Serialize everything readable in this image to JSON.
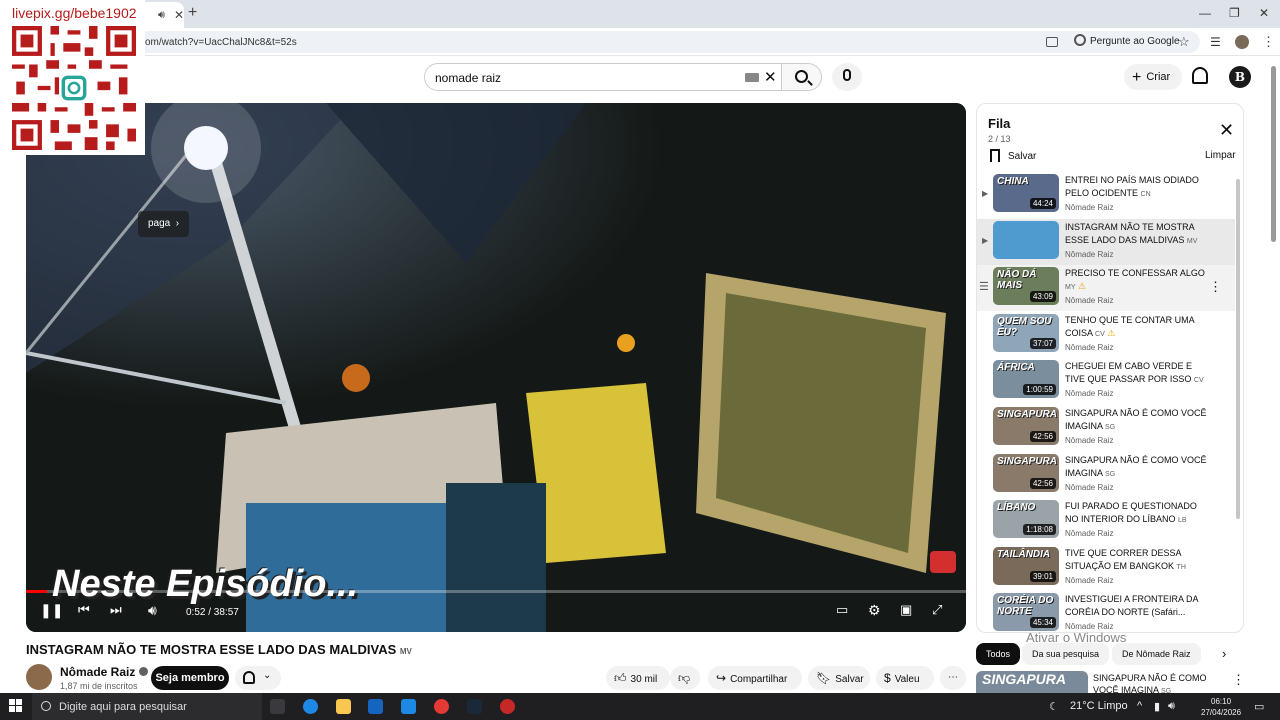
{
  "browser": {
    "tab_audio_icon": "speaker-icon",
    "url": "om/watch?v=UacChalJNc8&t=52s",
    "ask_google": "Pergunte ao Google"
  },
  "overlay": {
    "url_text": "livepix.gg/bebe1902"
  },
  "header": {
    "search_value": "nomade raiz",
    "create_label": "Criar",
    "avatar_letter": "B"
  },
  "player": {
    "badge": "paga",
    "caption": "Neste Episódio...",
    "current_time": "0:52",
    "duration": "38:57",
    "time_display": "0:52 / 38:57",
    "progress": 0.022
  },
  "video": {
    "title": "INSTAGRAM NÃO TE MOSTRA ESSE LADO DAS MALDIVAS 🇲🇻",
    "title_plain": "INSTAGRAM NÃO TE MOSTRA ESSE LADO DAS MALDIVAS",
    "title_flag": "MV",
    "channel": "Nômade Raiz",
    "subscribers": "1,87 mi de inscritos",
    "member_label": "Seja membro",
    "likes": "30 mil",
    "share_label": "Compartilhar",
    "save_label": "Salvar",
    "thanks_label": "Valeu"
  },
  "queue": {
    "title": "Fila",
    "count": "2 / 13",
    "save_label": "Salvar",
    "clear_label": "Limpar",
    "items": [
      {
        "title": "ENTREI NO PAÍS MAIS ODIADO PELO OCIDENTE",
        "flag": "CN",
        "channel": "Nômade Raiz",
        "duration": "44:24",
        "thumb_label": "CHINA",
        "thumb_color": "#5a6a8a",
        "warn": ""
      },
      {
        "title": "INSTAGRAM NÃO TE MOSTRA ESSE LADO DAS MALDIVAS",
        "flag": "MV",
        "channel": "Nômade Raiz",
        "duration": "",
        "thumb_label": "",
        "thumb_color": "#4f9bd0",
        "warn": ""
      },
      {
        "title": "PRECISO TE CONFESSAR ALGO",
        "flag": "MY",
        "channel": "Nômade Raiz",
        "duration": "43:09",
        "thumb_label": "NÃO DÁ MAIS",
        "thumb_color": "#6b7d5a",
        "warn": "⚠"
      },
      {
        "title": "TENHO QUE TE CONTAR UMA COISA",
        "flag": "CV",
        "channel": "Nômade Raiz",
        "duration": "37:07",
        "thumb_label": "QUEM SOU EU?",
        "thumb_color": "#8fa6b8",
        "warn": "⚠"
      },
      {
        "title": "CHEGUEI EM CABO VERDE E TIVE QUE PASSAR POR ISSO",
        "flag": "CV",
        "channel": "Nômade Raiz",
        "duration": "1:00:59",
        "thumb_label": "ÁFRICA",
        "thumb_color": "#7b8e9e",
        "warn": ""
      },
      {
        "title": "SINGAPURA NÃO É COMO VOCÊ IMAGINA",
        "flag": "SG",
        "channel": "Nômade Raiz",
        "duration": "42:56",
        "thumb_label": "SINGAPURA",
        "thumb_color": "#8a7a6a",
        "warn": ""
      },
      {
        "title": "SINGAPURA NÃO É COMO VOCÊ IMAGINA",
        "flag": "SG",
        "channel": "Nômade Raiz",
        "duration": "42:56",
        "thumb_label": "SINGAPURA",
        "thumb_color": "#8a7a6a",
        "warn": ""
      },
      {
        "title": "FUI PARADO E QUESTIONADO NO INTERIOR DO LÍBANO",
        "flag": "LB",
        "channel": "Nômade Raiz",
        "duration": "1:18:08",
        "thumb_label": "LÍBANO",
        "thumb_color": "#9aa3a8",
        "warn": ""
      },
      {
        "title": "TIVE QUE CORRER DESSA SITUAÇÃO EM BANGKOK",
        "flag": "TH",
        "channel": "Nômade Raiz",
        "duration": "39:01",
        "thumb_label": "TAILÂNDIA",
        "thumb_color": "#7a6a5a",
        "warn": ""
      },
      {
        "title": "INVESTIGUEI A FRONTEIRA DA CORÉIA DO NORTE (Safári...",
        "flag": "",
        "channel": "Nômade Raiz",
        "duration": "45:34",
        "thumb_label": "CORÉIA DO NORTE",
        "thumb_color": "#8a9aaa",
        "warn": ""
      }
    ]
  },
  "chips": [
    "Todos",
    "Da sua pesquisa",
    "De Nômade Raiz"
  ],
  "watermark": "Ativar o Windows",
  "recommendation": {
    "thumb_label": "SINGAPURA",
    "title": "SINGAPURA NÃO É COMO VOCÊ IMAGINA",
    "flag": "SG"
  },
  "taskbar": {
    "search_placeholder": "Digite aqui para pesquisar",
    "weather": "21°C  Limpo",
    "time": "06:10",
    "date": "27/04/2026"
  },
  "colors": {
    "accent": "#ff0000",
    "qr": "#b71c1c",
    "taskbar": "#1f1f22"
  }
}
